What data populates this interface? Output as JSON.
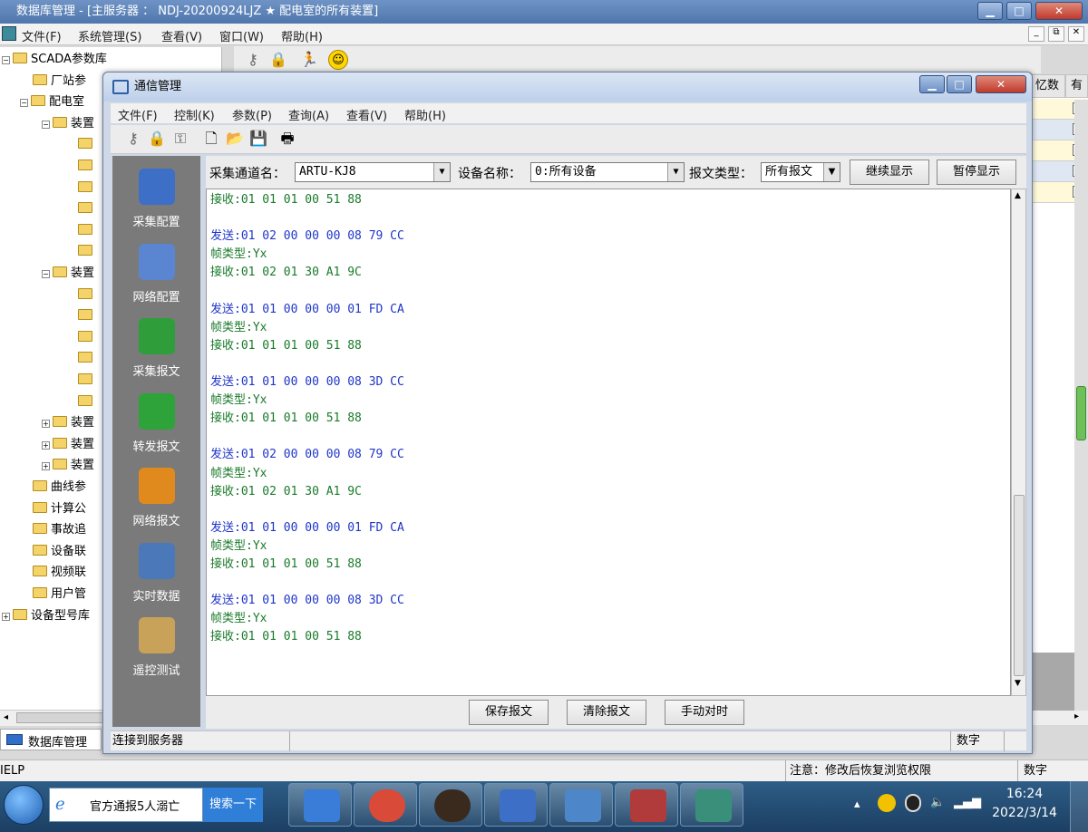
{
  "main_window": {
    "title": "数据库管理 - [主服务器 ： NDJ-20200924LJZ ★ 配电室的所有装置]",
    "menu": [
      "文件(F)",
      "系统管理(S)",
      "查看(V)",
      "窗口(W)",
      "帮助(H)"
    ],
    "tree": [
      {
        "label": "SCADA参数库",
        "level": 0,
        "expander": "-"
      },
      {
        "label": "厂站参",
        "level": 1,
        "expander": ""
      },
      {
        "label": "配电室",
        "level": 1,
        "expander": "-"
      },
      {
        "label": "装置",
        "level": 2,
        "expander": "-"
      },
      {
        "label": "",
        "level": 3,
        "expander": ""
      },
      {
        "label": "",
        "level": 3,
        "expander": ""
      },
      {
        "label": "",
        "level": 3,
        "expander": ""
      },
      {
        "label": "",
        "level": 3,
        "expander": ""
      },
      {
        "label": "",
        "level": 3,
        "expander": ""
      },
      {
        "label": "",
        "level": 3,
        "expander": ""
      },
      {
        "label": "装置",
        "level": 2,
        "expander": "-"
      },
      {
        "label": "",
        "level": 3,
        "expander": ""
      },
      {
        "label": "",
        "level": 3,
        "expander": ""
      },
      {
        "label": "",
        "level": 3,
        "expander": ""
      },
      {
        "label": "",
        "level": 3,
        "expander": ""
      },
      {
        "label": "",
        "level": 3,
        "expander": ""
      },
      {
        "label": "",
        "level": 3,
        "expander": ""
      },
      {
        "label": "装置",
        "level": 2,
        "expander": "+"
      },
      {
        "label": "装置",
        "level": 2,
        "expander": "+"
      },
      {
        "label": "装置",
        "level": 2,
        "expander": "+"
      },
      {
        "label": "曲线参",
        "level": 1,
        "expander": ""
      },
      {
        "label": "计算公",
        "level": 1,
        "expander": ""
      },
      {
        "label": "事故追",
        "level": 1,
        "expander": ""
      },
      {
        "label": "设备联",
        "level": 1,
        "expander": ""
      },
      {
        "label": "视频联",
        "level": 1,
        "expander": ""
      },
      {
        "label": "用户管",
        "level": 1,
        "expander": ""
      },
      {
        "label": "设备型号库",
        "level": 0,
        "expander": "+"
      }
    ],
    "tree_tab": "数据库管理",
    "grid_headers": [
      "忆数",
      "有"
    ],
    "grid_row_colors": [
      "#fff9d9",
      "#dfe7f3",
      "#fff9d9",
      "#dfe7f3",
      "#fff9d9"
    ],
    "status_left": "IELP",
    "status_note": "注意：修改后恢复浏览权限",
    "status_num": "数字"
  },
  "comm_window": {
    "title": "通信管理",
    "menu": [
      "文件(F)",
      "控制(K)",
      "参数(P)",
      "查询(A)",
      "查看(V)",
      "帮助(H)"
    ],
    "nav": [
      {
        "label": "采集配置",
        "icon": "config-icon",
        "color": "#3d6fc7"
      },
      {
        "label": "网络配置",
        "icon": "network-config-icon",
        "color": "#5a86d1"
      },
      {
        "label": "采集报文",
        "icon": "collect-message-icon",
        "color": "#2f9e3a"
      },
      {
        "label": "转发报文",
        "icon": "forward-message-icon",
        "color": "#2ea33a"
      },
      {
        "label": "网络报文",
        "icon": "network-message-icon",
        "color": "#e08a1e"
      },
      {
        "label": "实时数据",
        "icon": "realtime-data-icon",
        "color": "#4a78b8"
      },
      {
        "label": "遥控测试",
        "icon": "remote-control-icon",
        "color": "#c9a25a"
      }
    ],
    "controls": {
      "channel_label": "采集通道名：",
      "channel_value": "ARTU-KJ8",
      "device_label": "设备名称：",
      "device_value": "0:所有设备",
      "type_label": "报文类型：",
      "type_value": "所有报文",
      "continue_button": "继续显示",
      "pause_button": "暂停显示"
    },
    "log": [
      {
        "kind": "recv",
        "text": "接收:01 01 01 00 51 88"
      },
      {
        "kind": "blank",
        "text": ""
      },
      {
        "kind": "send",
        "text": "发送:01 02 00 00 00 08 79 CC"
      },
      {
        "kind": "frame",
        "text": "帧类型:Yx"
      },
      {
        "kind": "recv",
        "text": "接收:01 02 01 30 A1 9C"
      },
      {
        "kind": "blank",
        "text": ""
      },
      {
        "kind": "send",
        "text": "发送:01 01 00 00 00 01 FD CA"
      },
      {
        "kind": "frame",
        "text": "帧类型:Yx"
      },
      {
        "kind": "recv",
        "text": "接收:01 01 01 00 51 88"
      },
      {
        "kind": "blank",
        "text": ""
      },
      {
        "kind": "send",
        "text": "发送:01 01 00 00 00 08 3D CC"
      },
      {
        "kind": "frame",
        "text": "帧类型:Yx"
      },
      {
        "kind": "recv",
        "text": "接收:01 01 01 00 51 88"
      },
      {
        "kind": "blank",
        "text": ""
      },
      {
        "kind": "send",
        "text": "发送:01 02 00 00 00 08 79 CC"
      },
      {
        "kind": "frame",
        "text": "帧类型:Yx"
      },
      {
        "kind": "recv",
        "text": "接收:01 02 01 30 A1 9C"
      },
      {
        "kind": "blank",
        "text": ""
      },
      {
        "kind": "send",
        "text": "发送:01 01 00 00 00 01 FD CA"
      },
      {
        "kind": "frame",
        "text": "帧类型:Yx"
      },
      {
        "kind": "recv",
        "text": "接收:01 01 01 00 51 88"
      },
      {
        "kind": "blank",
        "text": ""
      },
      {
        "kind": "send",
        "text": "发送:01 01 00 00 00 08 3D CC"
      },
      {
        "kind": "frame",
        "text": "帧类型:Yx"
      },
      {
        "kind": "recv",
        "text": "接收:01 01 01 00 51 88"
      }
    ],
    "buttons": {
      "save": "保存报文",
      "clear": "清除报文",
      "manual": "手动对时"
    },
    "status": {
      "connection": "连接到服务器",
      "num": "数字"
    }
  },
  "taskbar": {
    "news_text": "官方通报5人溺亡",
    "search_button": "搜索一下",
    "clock_time": "16:24",
    "clock_date": "2022/3/14",
    "apps": [
      {
        "name": "ie-icon",
        "color": "#3a7dd8"
      },
      {
        "name": "chrome-icon",
        "color": "#d94a38"
      },
      {
        "name": "dark-app-icon",
        "color": "#3a2a1e"
      },
      {
        "name": "config-app-icon",
        "color": "#3d6fc7"
      },
      {
        "name": "comm-app-icon",
        "color": "#4d86c9"
      },
      {
        "name": "barcode-app-icon",
        "color": "#b13a3a"
      },
      {
        "name": "database-app-icon",
        "color": "#3a8f7a"
      }
    ]
  }
}
